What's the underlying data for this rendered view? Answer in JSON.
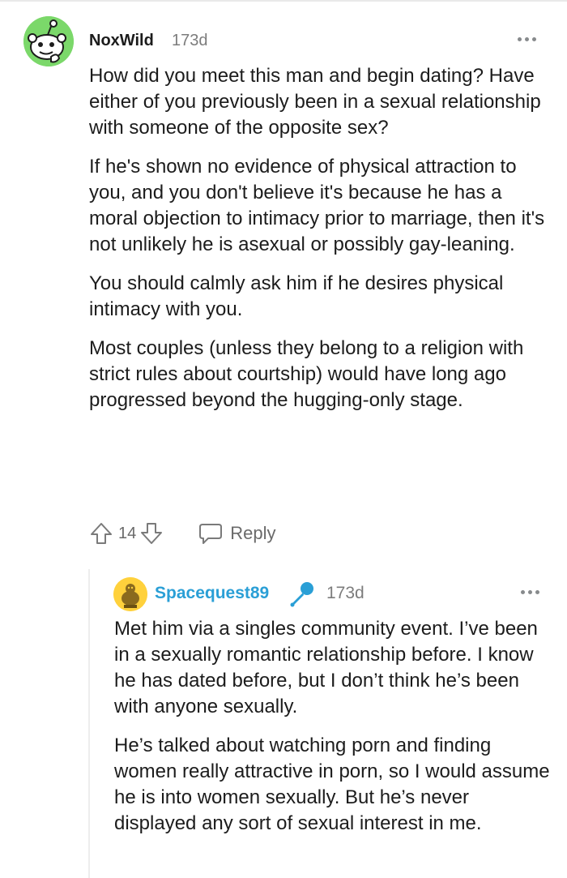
{
  "comment": {
    "username": "NoxWild",
    "age": "173d",
    "paragraphs": [
      "How did you meet this man and begin dating? Have either of you previously been in a sexual relationship with someone of the opposite sex?",
      "If he's shown no evidence of physical attraction to you, and you don't believe it's because he has a moral objection to intimacy prior to marriage, then it's not unlikely he is asexual or possibly gay-leaning.",
      "You should calmly ask him if he desires physical intimacy with you.",
      "Most couples (unless they belong to a religion with strict rules about courtship) would have long ago progressed beyond the hugging-only stage."
    ],
    "vote_count": "14",
    "reply_label": "Reply",
    "icons": {
      "avatar": "reddit-snoo-avatar",
      "more": "more-options-icon",
      "upvote": "upvote-arrow-icon",
      "downvote": "downvote-arrow-icon",
      "reply": "chat-bubble-icon"
    },
    "avatar_color": "#7bd86a"
  },
  "reply": {
    "username": "Spacequest89",
    "age": "173d",
    "paragraphs": [
      "Met him via a singles community event. I’ve been in a sexually romantic relationship before. I know he has dated before, but I don’t think he’s been with anyone sexually.",
      "He’s talked about watching porn and finding women really attractive in porn, so I would assume he is into women sexually. But he’s never displayed any sort of sexual interest in me."
    ],
    "username_color": "#2a9fd6",
    "avatar_color": "#ffd13c",
    "icons": {
      "avatar": "reddit-snoo-avatar",
      "badge": "microphone-icon",
      "more": "more-options-icon"
    }
  }
}
